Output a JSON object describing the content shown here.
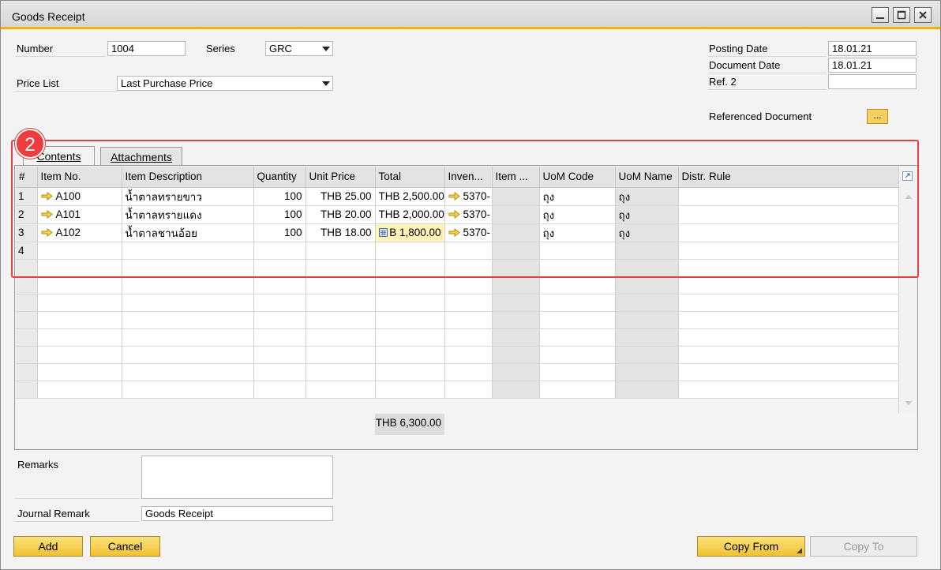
{
  "window": {
    "title": "Goods Receipt",
    "buttons": [
      "minimize-icon",
      "maximize-icon",
      "close-icon"
    ]
  },
  "header": {
    "number_label": "Number",
    "number_value": "1004",
    "series_label": "Series",
    "series_value": "GRC",
    "price_list_label": "Price List",
    "price_list_value": "Last Purchase Price",
    "posting_date_label": "Posting Date",
    "posting_date_value": "18.01.21",
    "document_date_label": "Document Date",
    "document_date_value": "18.01.21",
    "ref2_label": "Ref. 2",
    "ref2_value": "",
    "referenced_document_label": "Referenced Document",
    "referenced_document_button": "..."
  },
  "annotation": {
    "badge": "2",
    "highlight_color": "#e53f3f"
  },
  "tabs": [
    {
      "label": "Contents"
    },
    {
      "label": "Attachments"
    }
  ],
  "grid": {
    "columns": [
      "#",
      "Item No.",
      "Item Description",
      "Quantity",
      "Unit Price",
      "Total",
      "Inven...",
      "Item ...",
      "UoM Code",
      "UoM Name",
      "Distr. Rule"
    ],
    "rows": [
      {
        "num": "1",
        "item_no": "A100",
        "desc": "น้ำตาลทรายขาว",
        "qty": "100",
        "price": "THB 25.00",
        "total": "THB 2,500.00",
        "inv": "5370-",
        "item": "",
        "uom_code": "ถุง",
        "uom_name": "ถุง",
        "distr": ""
      },
      {
        "num": "2",
        "item_no": "A101",
        "desc": "น้ำตาลทรายแดง",
        "qty": "100",
        "price": "THB 20.00",
        "total": "THB 2,000.00",
        "inv": "5370-",
        "item": "",
        "uom_code": "ถุง",
        "uom_name": "ถุง",
        "distr": ""
      },
      {
        "num": "3",
        "item_no": "A102",
        "desc": "น้ำตาลชานอ้อย",
        "qty": "100",
        "price": "THB 18.00",
        "total": "B 1,800.00",
        "inv": "5370-",
        "item": "",
        "uom_code": "ถุง",
        "uom_name": "ถุง",
        "distr": ""
      },
      {
        "num": "4",
        "item_no": "",
        "desc": "",
        "qty": "",
        "price": "",
        "total": "",
        "inv": "",
        "item": "",
        "uom_code": "",
        "uom_name": "",
        "distr": ""
      }
    ],
    "grand_total": "THB 6,300.00"
  },
  "footer": {
    "remarks_label": "Remarks",
    "remarks_value": "",
    "journal_remark_label": "Journal Remark",
    "journal_remark_value": "Goods Receipt",
    "add_button": "Add",
    "cancel_button": "Cancel",
    "copy_from_button": "Copy From",
    "copy_to_button": "Copy To"
  }
}
